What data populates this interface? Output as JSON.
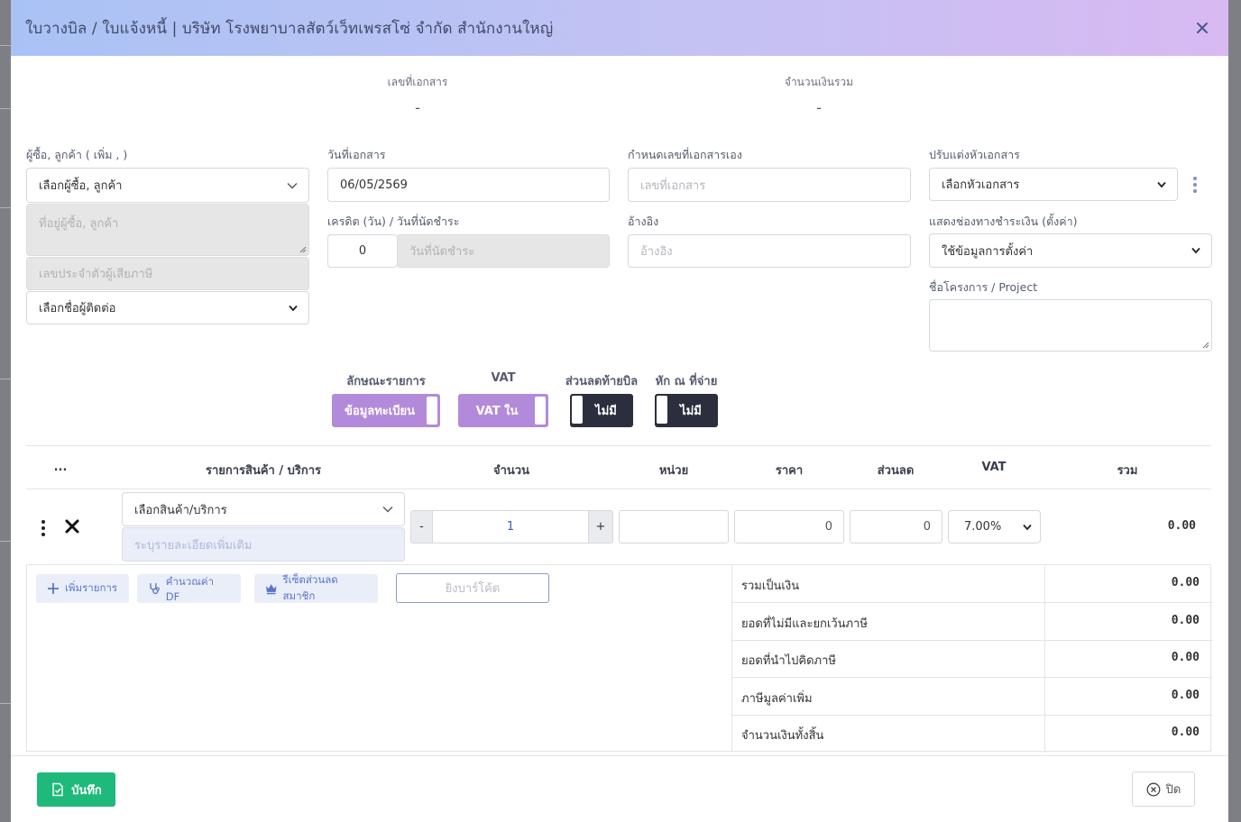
{
  "modal": {
    "title": "ใบวางบิล / ใบแจ้งหนี้ | บริษัท โรงพยาบาลสัตว์เว็ทเพรสโซ่ จำกัด สำนักงานใหญ่"
  },
  "summary": {
    "doc_no_label": "เลขที่เอกสาร",
    "doc_no_value": "-",
    "total_label": "จำนวนเงินรวม",
    "total_value": "-"
  },
  "customer": {
    "label": "ผู้ซื้อ, ลูกค้า ( เพิ่ม , )",
    "select_value": "เลือกผู้ซื้อ, ลูกค้า",
    "address_placeholder": "ที่อยู่ผู้ซื้อ, ลูกค้า",
    "taxid_placeholder": "เลขประจำตัวผู้เสียภาษี",
    "contact_value": "เลือกชื่อผู้ติดต่อ"
  },
  "doc_date": {
    "label": "วันที่เอกสาร",
    "value": "06/05/2569"
  },
  "credit": {
    "label": "เครดิต (วัน) / วันที่นัดชำระ",
    "days": "0",
    "due_placeholder": "วันที่นัดชำระ"
  },
  "custom_docno": {
    "label": "กำหนดเลขที่เอกสารเอง",
    "placeholder": "เลขที่เอกสาร"
  },
  "reference": {
    "label": "อ้างอิง",
    "placeholder": "อ้างอิง"
  },
  "header_custom": {
    "label": "ปรับแต่งหัวเอกสาร",
    "value": "เลือกหัวเอกสาร"
  },
  "payment_channel": {
    "label": "แสดงช่องทางชำระเงิน (ตั้งค่า)",
    "value": "ใช้ข้อมูลการตั้งค่า"
  },
  "project": {
    "label": "ชื่อโครงการ / Project"
  },
  "toggles": {
    "item_type_title": "ลักษณะรายการ",
    "item_type_value": "ข้อมูลทะเบียน",
    "vat_title": "VAT",
    "vat_value": "VAT ใน",
    "discount_title": "ส่วนลดท้ายบิล",
    "discount_value": "ไม่มี",
    "withholding_title": "หัก ณ ที่จ่าย",
    "withholding_value": "ไม่มี"
  },
  "table": {
    "headers": [
      "...",
      "รายการสินค้า / บริการ",
      "จำนวน",
      "หน่วย",
      "ราคา",
      "ส่วนลด",
      "VAT",
      "รวม"
    ],
    "row": {
      "product_value": "เลือกสินค้า/บริการ",
      "detail_placeholder": "ระบุรายละเอียดเพิ่มเติม",
      "minus": "-",
      "qty": "1",
      "plus": "+",
      "price": "0",
      "discount": "0",
      "vat": "7.00%",
      "total": "0.00"
    }
  },
  "actions": {
    "add_item": "เพิ่มรายการ",
    "calc_df": "คำนวณค่า DF",
    "member_discount": "รีเซ็ตส่วนลดสมาชิก",
    "barcode_placeholder": "ยิงบาร์โค้ด"
  },
  "totals": [
    {
      "label": "รวมเป็นเงิน",
      "value": "0.00"
    },
    {
      "label": "ยอดที่ไม่มีและยกเว้นภาษี",
      "value": "0.00"
    },
    {
      "label": "ยอดที่นำไปคิดภาษี",
      "value": "0.00"
    },
    {
      "label": "ภาษีมูลค่าเพิ่ม",
      "value": "0.00"
    },
    {
      "label": "จำนวนเงินทั้งสิ้น",
      "value": "0.00"
    }
  ],
  "footer": {
    "save": "บันทึก",
    "close": "ปิด"
  },
  "colors": {
    "toggle_on": "#b38ad9",
    "toggle_off": "#2b2f3d",
    "save_green": "#1fb97b",
    "action_blue": "#5b74c9"
  }
}
